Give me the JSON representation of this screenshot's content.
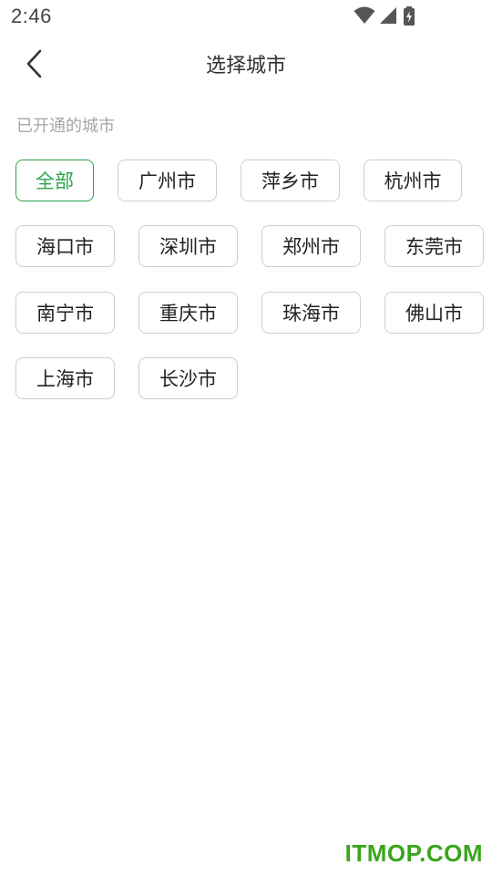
{
  "status_bar": {
    "time": "2:46",
    "icons": [
      "wifi-icon",
      "signal-icon",
      "battery-charging-icon"
    ]
  },
  "header": {
    "back_icon": "chevron-left-icon",
    "title": "选择城市"
  },
  "section": {
    "label": "已开通的城市"
  },
  "cities": [
    {
      "label": "全部",
      "selected": true
    },
    {
      "label": "广州市",
      "selected": false
    },
    {
      "label": "萍乡市",
      "selected": false
    },
    {
      "label": "杭州市",
      "selected": false
    },
    {
      "label": "海口市",
      "selected": false
    },
    {
      "label": "深圳市",
      "selected": false
    },
    {
      "label": "郑州市",
      "selected": false
    },
    {
      "label": "东莞市",
      "selected": false
    },
    {
      "label": "南宁市",
      "selected": false
    },
    {
      "label": "重庆市",
      "selected": false
    },
    {
      "label": "珠海市",
      "selected": false
    },
    {
      "label": "佛山市",
      "selected": false
    },
    {
      "label": "上海市",
      "selected": false
    },
    {
      "label": "长沙市",
      "selected": false
    }
  ],
  "colors": {
    "accent": "#2aa34a",
    "chip_border": "#cfcfcf",
    "label_gray": "#a6a6a6"
  },
  "watermark": "ITMOP.COM"
}
